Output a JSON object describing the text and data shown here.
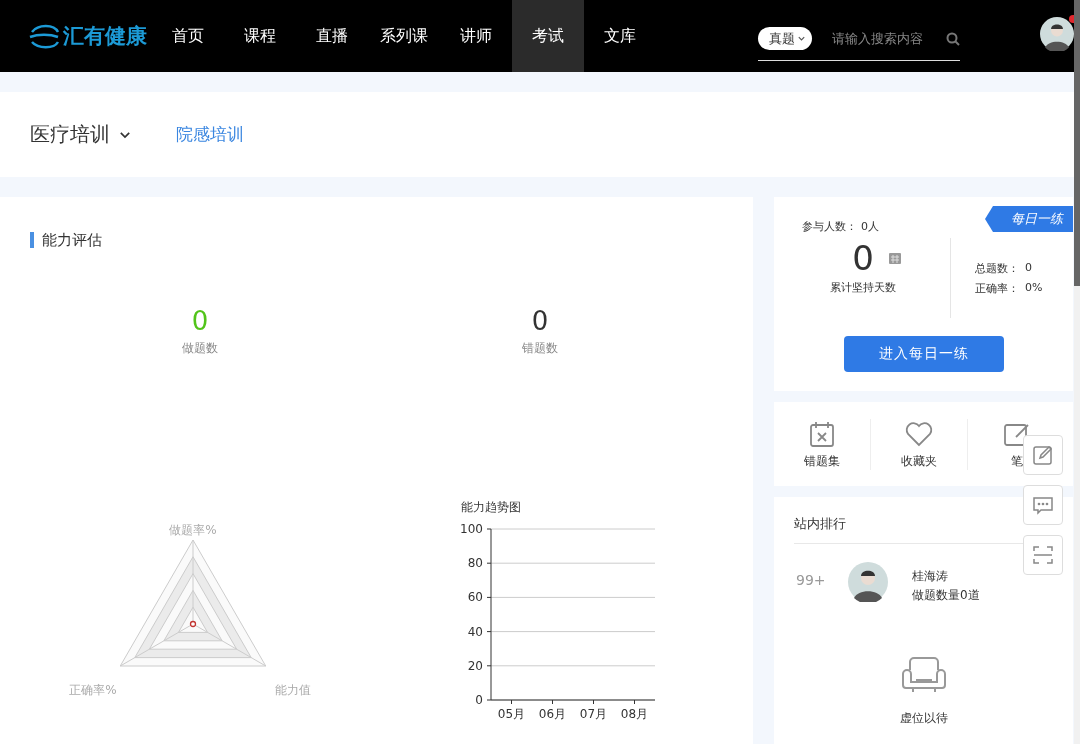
{
  "header": {
    "logo": "汇有健康",
    "nav": [
      {
        "label": "首页",
        "selected": false
      },
      {
        "label": "课程",
        "selected": false
      },
      {
        "label": "直播",
        "selected": false
      },
      {
        "label": "系列课",
        "selected": false
      },
      {
        "label": "讲师",
        "selected": false
      },
      {
        "label": "考试",
        "selected": true
      },
      {
        "label": "文库",
        "selected": false
      }
    ],
    "search": {
      "scope": "真题",
      "placeholder": "请输入搜索内容"
    },
    "user": {
      "has_notification": true
    }
  },
  "categories": {
    "current": "医疗培训",
    "items": [
      {
        "label": "院感培训",
        "selected": true
      }
    ]
  },
  "ability": {
    "title": "能力评估",
    "stats": [
      {
        "value": "0",
        "label": "做题数",
        "kind": "done"
      },
      {
        "value": "0",
        "label": "错题数",
        "kind": "wrong"
      }
    ],
    "radar": {
      "axes": [
        "做题率%",
        "能力值",
        "正确率%"
      ]
    },
    "trend": {
      "chart_data": {
        "type": "line",
        "title": "能力趋势图",
        "categories": [
          "05月",
          "06月",
          "07月",
          "08月"
        ],
        "ylim": [
          0,
          100
        ],
        "grid": true,
        "yticks": [
          0,
          20,
          40,
          60,
          80,
          100
        ]
      }
    }
  },
  "daily": {
    "badge": "每日一练",
    "participants_label": "参与人数：",
    "participants": "0人",
    "days": "0",
    "days_label": "累计坚持天数",
    "total_label": "总题数：",
    "total": "0",
    "accuracy_label": "正确率：",
    "accuracy": "0%",
    "button": "进入每日一练"
  },
  "shortcuts": [
    {
      "label": "错题集",
      "kind": "wrong"
    },
    {
      "label": "收藏夹",
      "kind": "favorite"
    },
    {
      "label": "笔",
      "kind": "note"
    }
  ],
  "ranking": {
    "title": "站内排行",
    "rank": "99+",
    "name": "桂海涛",
    "detail": "做题数量0道",
    "empty_label": "虚位以待"
  },
  "floating_tools": [
    {
      "kind": "edit"
    },
    {
      "kind": "message"
    },
    {
      "kind": "scan"
    }
  ]
}
